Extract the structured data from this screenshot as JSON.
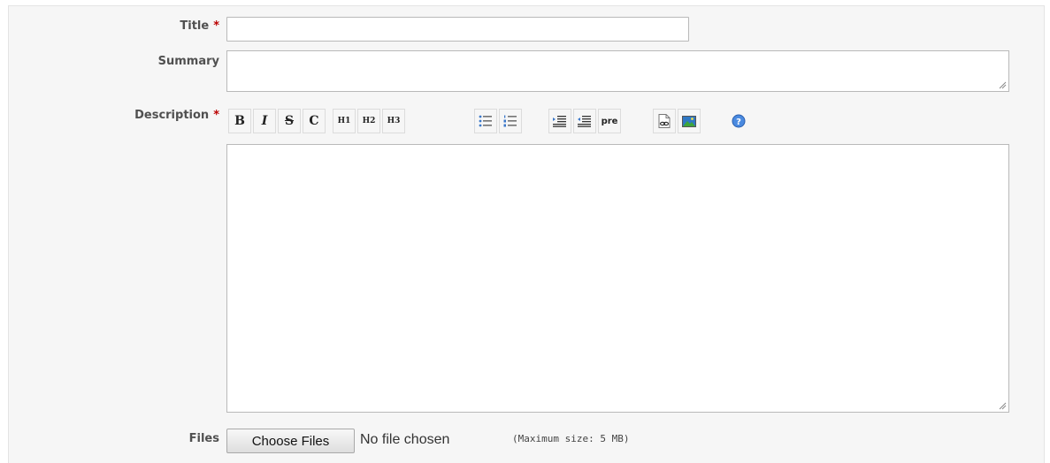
{
  "form": {
    "title_label": "Title",
    "summary_label": "Summary",
    "description_label": "Description",
    "files_label": "Files",
    "required_mark": "*",
    "title_value": "",
    "summary_value": "",
    "description_value": ""
  },
  "toolbar": {
    "bold": "B",
    "italic": "I",
    "strike": "S",
    "code": "C",
    "h1": "H1",
    "h2": "H2",
    "h3": "H3",
    "pre": "pre",
    "icons": [
      "bold",
      "italic",
      "strikethrough",
      "inline-code",
      "heading-1",
      "heading-2",
      "heading-3",
      "unordered-list",
      "ordered-list",
      "indent",
      "outdent",
      "preformatted",
      "link",
      "image",
      "help"
    ]
  },
  "files": {
    "button_label": "Choose Files",
    "status": "No file chosen",
    "max_size": "(Maximum size: 5 MB)"
  },
  "colors": {
    "required": "#bb0000",
    "label": "#505050",
    "panel_bg": "#f6f6f6"
  }
}
